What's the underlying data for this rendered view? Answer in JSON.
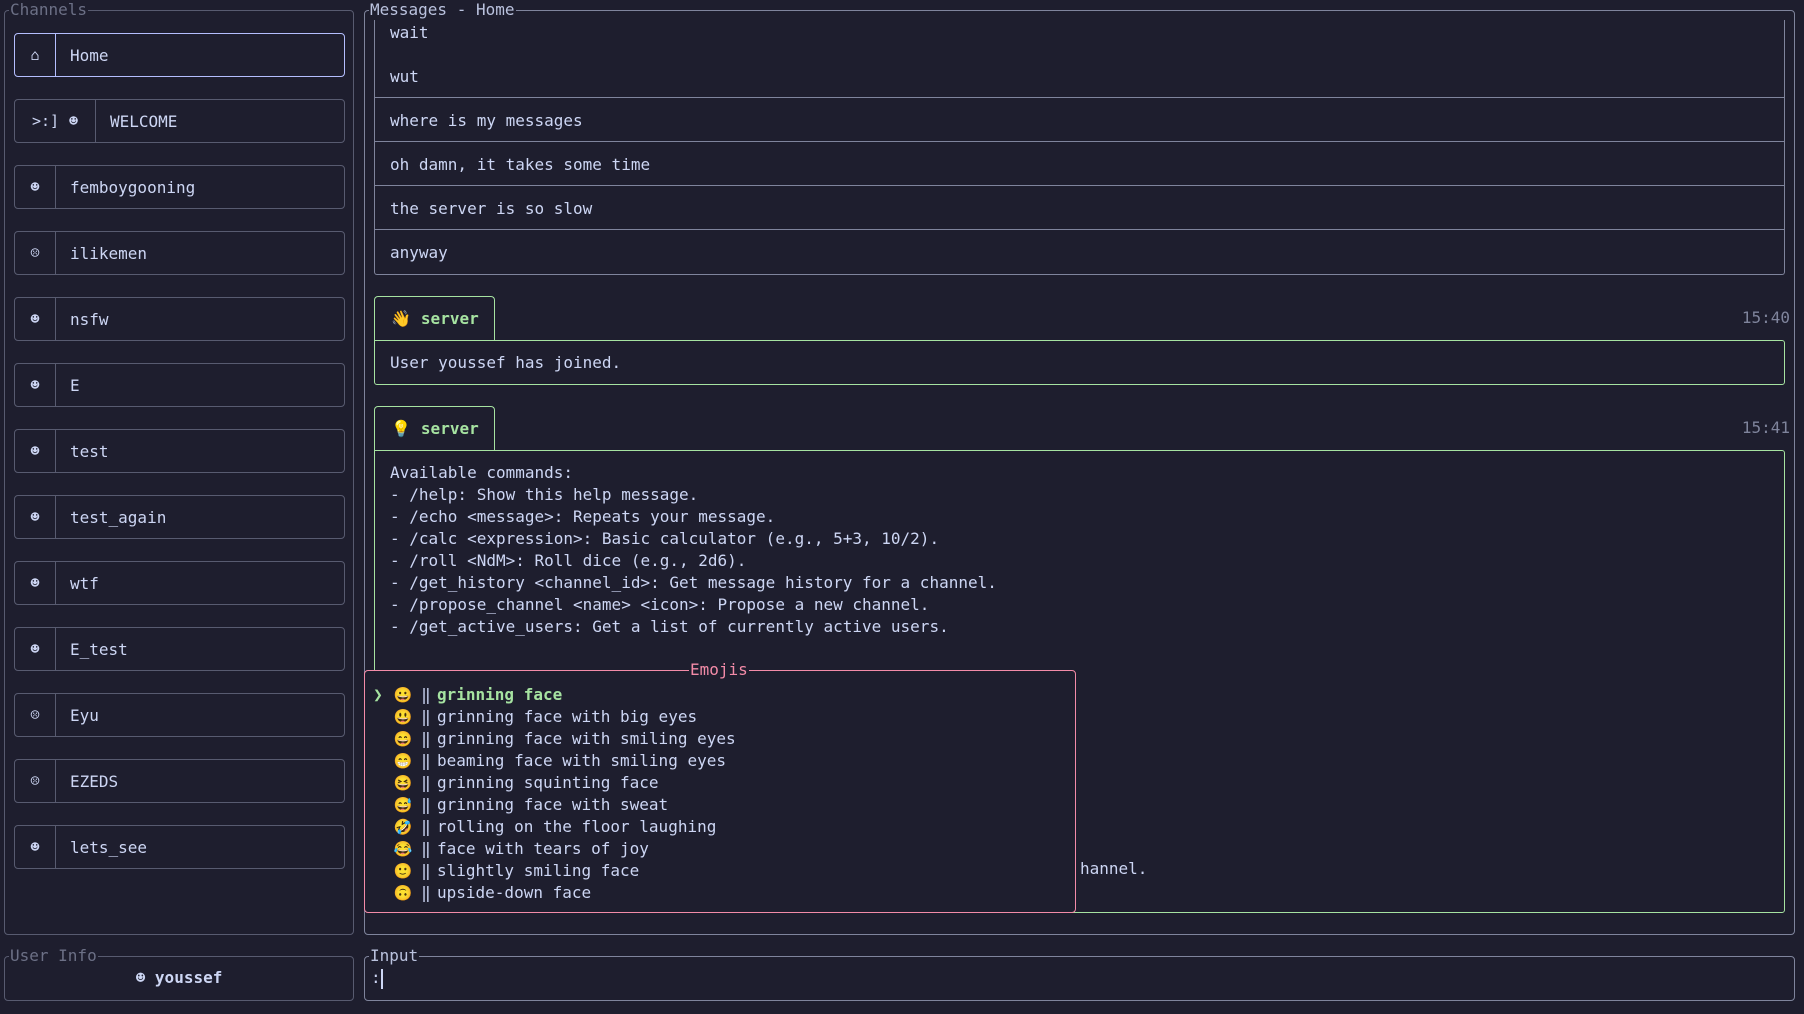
{
  "sidebar": {
    "title": "Channels",
    "channels": [
      {
        "icon": "home-icon",
        "glyph": "⌂",
        "prefix": "",
        "label": "Home"
      },
      {
        "icon": "smile-icon",
        "glyph": "☻",
        "prefix": ">:]",
        "label": "WELCOME"
      },
      {
        "icon": "smile-icon",
        "glyph": "☻",
        "prefix": "",
        "label": "femboygooning"
      },
      {
        "icon": "smile-icon",
        "glyph": "☹",
        "prefix": "",
        "label": "ilikemen"
      },
      {
        "icon": "smile-icon",
        "glyph": "☻",
        "prefix": "",
        "label": "nsfw"
      },
      {
        "icon": "smile-icon",
        "glyph": "☻",
        "prefix": "",
        "label": "E"
      },
      {
        "icon": "smile-icon",
        "glyph": "☻",
        "prefix": "",
        "label": "test"
      },
      {
        "icon": "smile-icon",
        "glyph": "☻",
        "prefix": "",
        "label": "test_again"
      },
      {
        "icon": "smile-icon",
        "glyph": "☻",
        "prefix": "",
        "label": "wtf"
      },
      {
        "icon": "smile-icon",
        "glyph": "☻",
        "prefix": "",
        "label": "E_test"
      },
      {
        "icon": "smile-icon",
        "glyph": "☹",
        "prefix": "",
        "label": "Eyu"
      },
      {
        "icon": "smile-icon",
        "glyph": "☹",
        "prefix": "",
        "label": "EZEDS"
      },
      {
        "icon": "smile-icon",
        "glyph": "☻",
        "prefix": "",
        "label": "lets_see"
      }
    ]
  },
  "messages": {
    "title": "Messages - Home",
    "plain": [
      "wait",
      "wut",
      "where is my messages",
      "oh damn, it takes some time",
      "the server is so slow",
      "anyway"
    ],
    "join": {
      "author": "server",
      "emoji": "👋",
      "time": "15:40",
      "text": "User youssef has joined."
    },
    "help": {
      "author": "server",
      "emoji": "💡",
      "time": "15:41",
      "lines": [
        "Available commands:",
        "- /help: Show this help message.",
        "- /echo <message>: Repeats your message.",
        "- /calc <expression>: Basic calculator (e.g., 5+3, 10/2).",
        "- /roll <NdM>: Roll dice (e.g., 2d6).",
        "- /get_history <channel_id>: Get message history for a channel.",
        "- /propose_channel <name> <icon>: Propose a new channel.",
        "- /get_active_users: Get a list of currently active users."
      ],
      "overflow_text": "hannel."
    }
  },
  "emoji_popup": {
    "title": "Emojis",
    "caret": "❯",
    "separator": "‖",
    "items": [
      {
        "emoji": "😀",
        "name": "grinning face",
        "selected": true
      },
      {
        "emoji": "😃",
        "name": "grinning face with big eyes"
      },
      {
        "emoji": "😄",
        "name": "grinning face with smiling eyes"
      },
      {
        "emoji": "😁",
        "name": "beaming face with smiling eyes"
      },
      {
        "emoji": "😆",
        "name": "grinning squinting face"
      },
      {
        "emoji": "😅",
        "name": "grinning face with sweat"
      },
      {
        "emoji": "🤣",
        "name": "rolling on the floor laughing"
      },
      {
        "emoji": "😂",
        "name": "face with tears of joy"
      },
      {
        "emoji": "🙂",
        "name": "slightly smiling face"
      },
      {
        "emoji": "🙃",
        "name": "upside-down face"
      }
    ]
  },
  "user_info": {
    "title": "User Info",
    "icon": "☻",
    "username": "youssef"
  },
  "input": {
    "title": "Input",
    "value": ":"
  },
  "colors": {
    "background": "#1e1e2e",
    "accent": "#b4befe",
    "green": "#a6e3a1",
    "pink": "#f38ba8"
  }
}
